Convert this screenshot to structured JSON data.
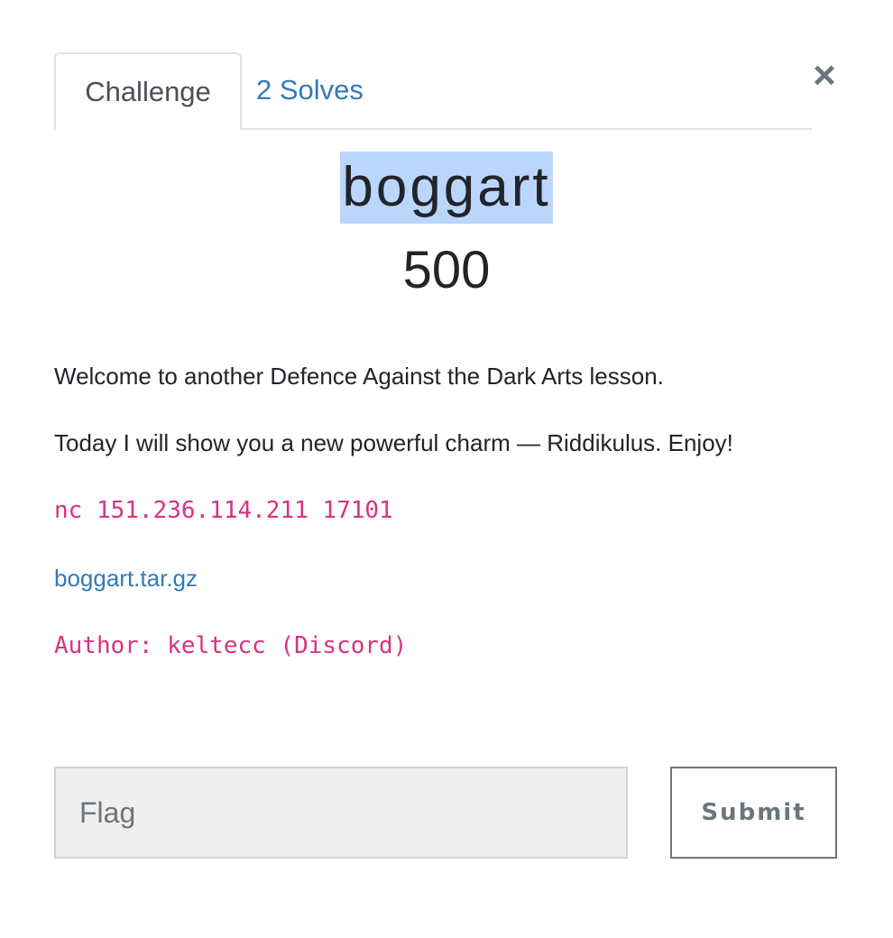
{
  "tabs": [
    {
      "label": "Challenge"
    },
    {
      "label": "2 Solves"
    }
  ],
  "close_label": "×",
  "challenge": {
    "name": "boggart",
    "points": "500",
    "description": [
      "Welcome to another Defence Against the Dark Arts lesson.",
      "Today I will show you a new powerful charm — Riddikulus. Enjoy!"
    ],
    "command": "nc 151.236.114.211 17101",
    "file_link": "boggart.tar.gz",
    "author": "Author: keltecc (Discord)"
  },
  "form": {
    "flag_placeholder": "Flag",
    "submit_label": "Submit"
  }
}
